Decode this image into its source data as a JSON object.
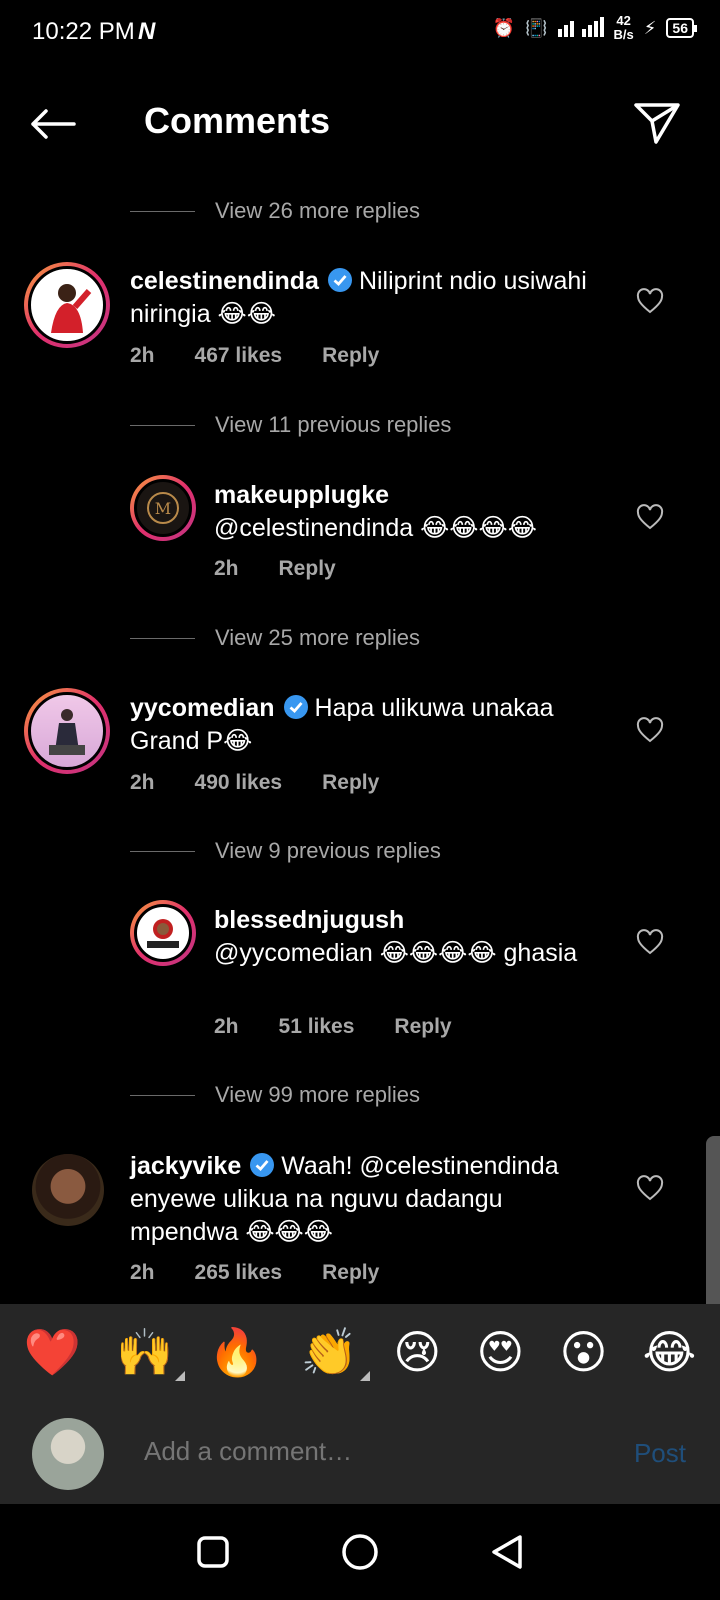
{
  "status_bar": {
    "time": "10:22 PM",
    "carrier_icon": "N",
    "speed_value": "42",
    "speed_unit": "B/s",
    "battery": "56"
  },
  "header": {
    "title": "Comments"
  },
  "comments": [
    {
      "view_replies": "View 26 more replies"
    },
    {
      "username": "celestinendinda",
      "verified": true,
      "text": "Niliprint ndio usiwahi niringia 😂😂",
      "time": "2h",
      "likes": "467 likes",
      "reply": "Reply"
    },
    {
      "view_replies": "View 11 previous replies"
    },
    {
      "username": "makeupplugke",
      "verified": false,
      "text": "@celestinendinda 😂😂😂😂",
      "time": "2h",
      "likes": "",
      "reply": "Reply"
    },
    {
      "view_replies": "View 25 more replies"
    },
    {
      "username": "yycomedian",
      "verified": true,
      "text": "Hapa ulikuwa unakaa Grand P😂",
      "time": "2h",
      "likes": "490 likes",
      "reply": "Reply"
    },
    {
      "view_replies": "View 9 previous replies"
    },
    {
      "username": "blessednjugush",
      "verified": false,
      "text": "@yycomedian 😂😂😂😂 ghasia",
      "time": "2h",
      "likes": "51 likes",
      "reply": "Reply"
    },
    {
      "view_replies": "View 99 more replies"
    },
    {
      "username": "jackyvike",
      "verified": true,
      "text": "Waah! @celestinendinda enyewe ulikua na nguvu dadangu mpendwa 😂😂😂",
      "time": "2h",
      "likes": "265 likes",
      "reply": "Reply"
    }
  ],
  "emoji_bar": [
    "❤️",
    "🙌",
    "🔥",
    "👏",
    "😢",
    "😍",
    "😮",
    "😂"
  ],
  "composer": {
    "placeholder": "Add a comment…",
    "post_label": "Post"
  },
  "colors": {
    "background": "#000000",
    "muted_text": "#a8a8a8",
    "verified_blue": "#3897f0",
    "post_disabled": "#1f4e7a",
    "bar_bg": "#262626"
  }
}
